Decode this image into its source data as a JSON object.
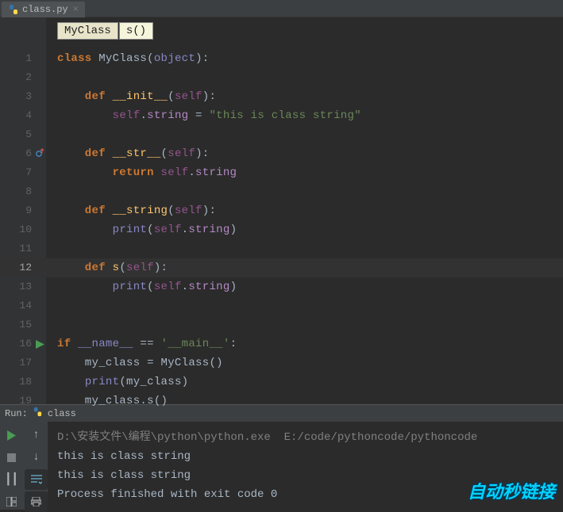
{
  "tab": {
    "filename": "class.py",
    "icon": "python-file-icon"
  },
  "breadcrumbs": [
    {
      "label": "MyClass"
    },
    {
      "label": "s()"
    }
  ],
  "gutter": {
    "override_line": 6,
    "run_line": 16,
    "highlighted_line": 12,
    "line_count": 19
  },
  "code": {
    "lines": [
      {
        "n": 1,
        "tokens": [
          [
            "class ",
            "kw"
          ],
          [
            "MyClass",
            "cls"
          ],
          [
            "(",
            "p"
          ],
          [
            "object",
            "bi"
          ],
          [
            ")",
            "p"
          ],
          [
            ":",
            "p"
          ]
        ]
      },
      {
        "n": 2,
        "tokens": []
      },
      {
        "n": 3,
        "tokens": [
          [
            "    def ",
            "kw"
          ],
          [
            "__init__",
            "fn"
          ],
          [
            "(",
            "p"
          ],
          [
            "self",
            "self"
          ],
          [
            ")",
            "p"
          ],
          [
            ":",
            "p"
          ]
        ]
      },
      {
        "n": 4,
        "tokens": [
          [
            "        ",
            "p"
          ],
          [
            "self",
            "self"
          ],
          [
            ".",
            "p"
          ],
          [
            "string",
            "attr"
          ],
          [
            " = ",
            "op"
          ],
          [
            "\"this is class string\"",
            "str"
          ]
        ]
      },
      {
        "n": 5,
        "tokens": []
      },
      {
        "n": 6,
        "tokens": [
          [
            "    def ",
            "kw"
          ],
          [
            "__str__",
            "fn"
          ],
          [
            "(",
            "p"
          ],
          [
            "self",
            "self"
          ],
          [
            ")",
            "p"
          ],
          [
            ":",
            "p"
          ]
        ]
      },
      {
        "n": 7,
        "tokens": [
          [
            "        return ",
            "kw"
          ],
          [
            "self",
            "self"
          ],
          [
            ".",
            "p"
          ],
          [
            "string",
            "attr"
          ]
        ]
      },
      {
        "n": 8,
        "tokens": []
      },
      {
        "n": 9,
        "tokens": [
          [
            "    def ",
            "kw"
          ],
          [
            "__string",
            "fn"
          ],
          [
            "(",
            "p"
          ],
          [
            "self",
            "self"
          ],
          [
            ")",
            "p"
          ],
          [
            ":",
            "p"
          ]
        ]
      },
      {
        "n": 10,
        "tokens": [
          [
            "        ",
            "p"
          ],
          [
            "print",
            "bi"
          ],
          [
            "(",
            "p"
          ],
          [
            "self",
            "self"
          ],
          [
            ".",
            "p"
          ],
          [
            "string",
            "attr"
          ],
          [
            ")",
            "p"
          ]
        ]
      },
      {
        "n": 11,
        "tokens": []
      },
      {
        "n": 12,
        "tokens": [
          [
            "    def ",
            "kw"
          ],
          [
            "s",
            "fn"
          ],
          [
            "(",
            "p"
          ],
          [
            "self",
            "self"
          ],
          [
            ")",
            "p"
          ],
          [
            ":",
            "p"
          ]
        ],
        "hl": true
      },
      {
        "n": 13,
        "tokens": [
          [
            "        ",
            "p"
          ],
          [
            "print",
            "bi"
          ],
          [
            "(",
            "p"
          ],
          [
            "self",
            "self"
          ],
          [
            ".",
            "p"
          ],
          [
            "string",
            "attr"
          ],
          [
            ")",
            "p"
          ]
        ]
      },
      {
        "n": 14,
        "tokens": []
      },
      {
        "n": 15,
        "tokens": []
      },
      {
        "n": 16,
        "tokens": [
          [
            "if ",
            "kw"
          ],
          [
            "__name__",
            "bi"
          ],
          [
            " == ",
            "op"
          ],
          [
            "'__main__'",
            "str"
          ],
          [
            ":",
            "p"
          ]
        ]
      },
      {
        "n": 17,
        "tokens": [
          [
            "    my_class = ",
            "p"
          ],
          [
            "MyClass",
            "cls"
          ],
          [
            "()",
            "p"
          ]
        ]
      },
      {
        "n": 18,
        "tokens": [
          [
            "    ",
            "p"
          ],
          [
            "print",
            "bi"
          ],
          [
            "(",
            "p"
          ],
          [
            "my_class",
            "p"
          ],
          [
            ")",
            "p"
          ]
        ]
      },
      {
        "n": 19,
        "tokens": [
          [
            "    my_class.s()",
            "p"
          ]
        ]
      }
    ]
  },
  "run": {
    "label_prefix": "Run:",
    "config_name": "class",
    "console_lines": [
      {
        "text": "D:\\安装文件\\编程\\python\\python.exe  E:/code/pythoncode/pythoncode",
        "cls": "cmd"
      },
      {
        "text": "this is class string",
        "cls": ""
      },
      {
        "text": "this is class string",
        "cls": ""
      },
      {
        "text": "",
        "cls": ""
      },
      {
        "text": "Process finished with exit code 0",
        "cls": ""
      }
    ]
  },
  "watermark": "自动秒链接"
}
